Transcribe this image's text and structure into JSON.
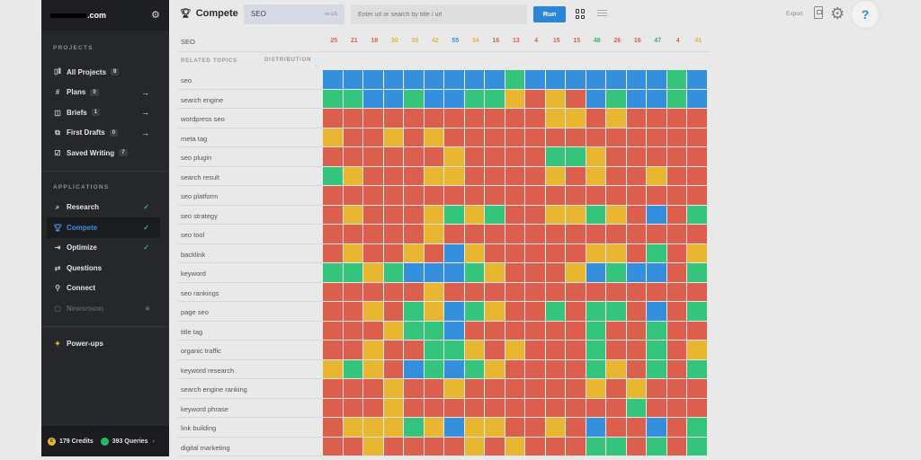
{
  "sidebar": {
    "logo_suffix": ".com",
    "projects_heading": "PROJECTS",
    "projects": [
      {
        "label": "All Projects",
        "badge": "8",
        "icon": "columns-icon",
        "glyph": "▯⦀",
        "arrow": ""
      },
      {
        "label": "Plans",
        "badge": "0",
        "icon": "hash-icon",
        "glyph": "#",
        "arrow": "→"
      },
      {
        "label": "Briefs",
        "badge": "1",
        "icon": "brief-icon",
        "glyph": "◫",
        "arrow": "→"
      },
      {
        "label": "First Drafts",
        "badge": "0",
        "icon": "drafts-icon",
        "glyph": "⧉",
        "arrow": "→"
      },
      {
        "label": "Saved Writing",
        "badge": "7",
        "icon": "edit-icon",
        "glyph": "☑",
        "arrow": ""
      }
    ],
    "applications_heading": "APPLICATIONS",
    "applications": [
      {
        "label": "Research",
        "icon": "search-icon",
        "glyph": "⌕",
        "check": "✓",
        "active": false,
        "disabled": false
      },
      {
        "label": "Compete",
        "icon": "trophy-icon",
        "glyph": "🏆︎",
        "check": "✓",
        "active": true,
        "disabled": false
      },
      {
        "label": "Optimize",
        "icon": "optimize-icon",
        "glyph": "⇥",
        "check": "✓",
        "active": false,
        "disabled": false
      },
      {
        "label": "Questions",
        "icon": "questions-icon",
        "glyph": "⇄",
        "check": "",
        "active": false,
        "disabled": false
      },
      {
        "label": "Connect",
        "icon": "link-icon",
        "glyph": "⚲",
        "check": "",
        "active": false,
        "disabled": false
      },
      {
        "label": "Newsroom",
        "icon": "newsroom-icon",
        "glyph": "▢",
        "check": "🔒︎",
        "active": false,
        "disabled": true
      }
    ],
    "powerups_label": "Power-ups",
    "credits_label": "179 Credits",
    "queries_label": "393 Queries"
  },
  "topbar": {
    "title": "Compete",
    "keyword_value": "SEO",
    "keyword_location": "en US",
    "url_placeholder": "Enter url or search by title / url",
    "run_label": "Run",
    "export_label": "Export",
    "help_label": "?"
  },
  "colors": {
    "B": "#3490dc",
    "G": "#34c47c",
    "Y": "#e9b632",
    "R": "#dc5f4e",
    "score_red": "#d9604f",
    "score_yellow": "#e6b53a",
    "score_green": "#34b36e",
    "score_blue": "#3490dc"
  },
  "main": {
    "keyword_row_label": "SEO",
    "scores": [
      {
        "v": "25",
        "c": "R"
      },
      {
        "v": "21",
        "c": "R"
      },
      {
        "v": "18",
        "c": "R"
      },
      {
        "v": "30",
        "c": "Y"
      },
      {
        "v": "39",
        "c": "Y"
      },
      {
        "v": "42",
        "c": "Y"
      },
      {
        "v": "55",
        "c": "B"
      },
      {
        "v": "34",
        "c": "Y"
      },
      {
        "v": "16",
        "c": "R"
      },
      {
        "v": "13",
        "c": "R"
      },
      {
        "v": "4",
        "c": "R"
      },
      {
        "v": "15",
        "c": "R"
      },
      {
        "v": "15",
        "c": "R"
      },
      {
        "v": "48",
        "c": "G"
      },
      {
        "v": "26",
        "c": "R"
      },
      {
        "v": "16",
        "c": "R"
      },
      {
        "v": "47",
        "c": "G"
      },
      {
        "v": "4",
        "c": "R"
      },
      {
        "v": "41",
        "c": "Y"
      }
    ],
    "related_topics_heading": "RELATED TOPICS",
    "distribution_heading": "DISTRIBUTION",
    "topics": [
      {
        "label": "seo",
        "cells": "BBBBBBBBBGBBBBBBBGB"
      },
      {
        "label": "search engine",
        "cells": "GGBBGBBGGYRYRBGBBGB"
      },
      {
        "label": "wordpress seo",
        "cells": "RRRRRRRRRRRYYRYRRRR"
      },
      {
        "label": "meta tag",
        "cells": "YRRYRYRRRRRRRRRRRRR"
      },
      {
        "label": "seo plugin",
        "cells": "RRRRRRYRRRRGGYRRRRR"
      },
      {
        "label": "search result",
        "cells": "GYRRRYYRRRRYRYRRYRR"
      },
      {
        "label": "seo platform",
        "cells": "RRRRRRRRRRRRRRRRRRR"
      },
      {
        "label": "seo strategy",
        "cells": "RYRRRYGYGRRYYGYRBRG"
      },
      {
        "label": "seo tool",
        "cells": "RRRRRYRRRRRRRRRRRRR"
      },
      {
        "label": "backlink",
        "cells": "RYRRYRBYRRRRRYYRGRY"
      },
      {
        "label": "keyword",
        "cells": "GGYGBBBGYRRRYBGBBRG"
      },
      {
        "label": "seo rankings",
        "cells": "RRRRRYRRRRRRRRRRRRR"
      },
      {
        "label": "page seo",
        "cells": "RRYRGYBGYRRGRGGRBRG"
      },
      {
        "label": "title tag",
        "cells": "RRRYGGBRRRRRRGRRGRR"
      },
      {
        "label": "organic traffic",
        "cells": "RRYRRGGYRYRRRGRRGRY"
      },
      {
        "label": "keyword research",
        "cells": "YGYRBGBGYRRRRGYRGRG"
      },
      {
        "label": "search engine ranking",
        "cells": "RRRYRRYRRRRRRYRYRRR"
      },
      {
        "label": "keyword phrase",
        "cells": "RRRYRRRRRRRRRRRGRRR"
      },
      {
        "label": "link building",
        "cells": "RYYYGYBYYRRYRBRRBRG"
      },
      {
        "label": "digital marketing",
        "cells": "RRYRRRRYRYRRRGGRGRG"
      }
    ]
  }
}
